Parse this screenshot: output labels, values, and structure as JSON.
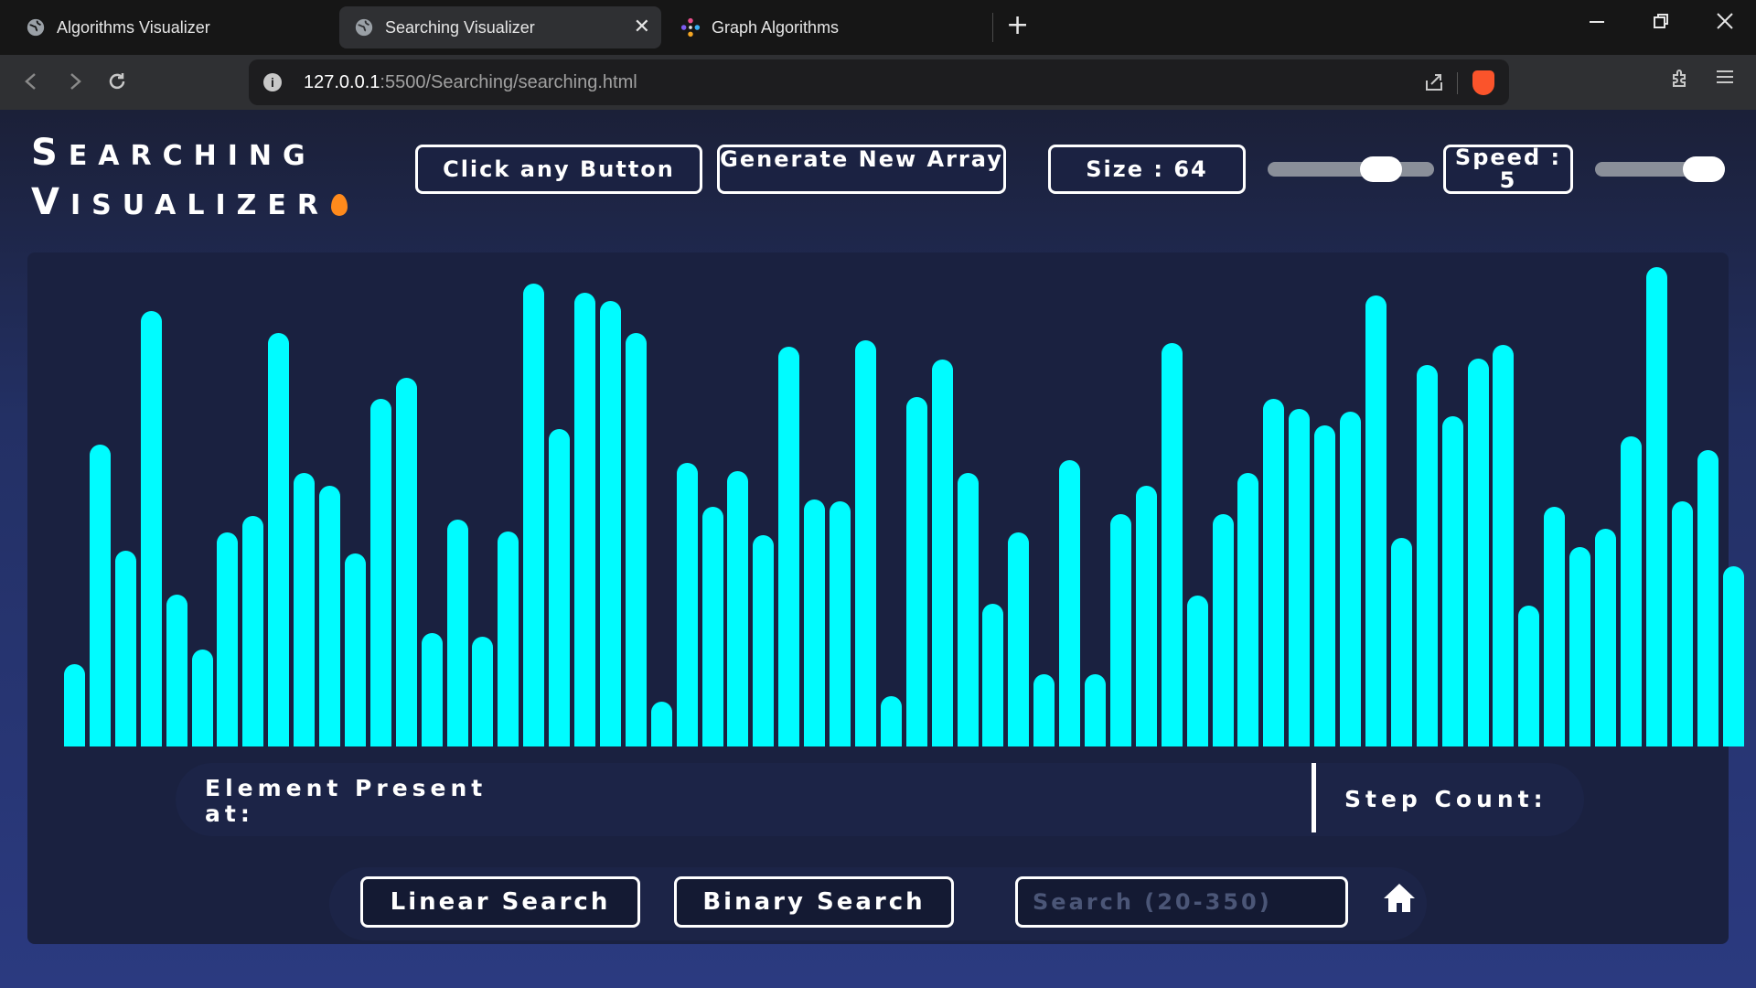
{
  "browser": {
    "tabs": [
      {
        "title": "Algorithms Visualizer",
        "icon": "globe-icon",
        "active": false
      },
      {
        "title": "Searching Visualizer",
        "icon": "globe-icon",
        "active": true
      },
      {
        "title": "Graph Algorithms",
        "icon": "graph-app-icon",
        "active": false
      }
    ],
    "new_tab_label": "+",
    "close_tab_glyph": "✕",
    "url": {
      "host": "127.0.0.1",
      "path": ":5500/Searching/searching.html"
    }
  },
  "header": {
    "logo_line1": {
      "cap": "S",
      "rest": "EARCHING"
    },
    "logo_line2": {
      "cap": "V",
      "rest": "ISUALIZER"
    },
    "status_button": "Click any Button",
    "generate_button": "Generate New Array",
    "size_label": "Size : 64",
    "size_slider_value": 0.74,
    "speed_label": "Speed : 5",
    "speed_slider_value": 1.0
  },
  "results": {
    "element_label": "Element Present at:",
    "step_label": "Step Count:"
  },
  "controls": {
    "linear_button": "Linear Search",
    "binary_button": "Binary Search",
    "search_placeholder": "Search (20-350)",
    "search_value": ""
  },
  "colors": {
    "bar": "#00fcff",
    "panel": "#1a2140",
    "accent_white": "#ffffff"
  },
  "array_values": [
    64,
    234,
    152,
    338,
    118,
    75,
    166,
    179,
    321,
    212,
    202,
    150,
    270,
    286,
    88,
    176,
    85,
    167,
    359,
    246,
    352,
    346,
    321,
    35,
    220,
    186,
    214,
    164,
    310,
    192,
    190,
    315,
    39,
    271,
    300,
    212,
    111,
    166,
    56,
    222,
    56,
    180,
    202,
    313,
    117,
    180,
    212,
    270,
    262,
    249,
    260,
    350,
    162,
    296,
    256,
    301,
    312,
    109,
    186,
    155,
    169,
    241,
    372,
    190,
    230,
    140
  ]
}
